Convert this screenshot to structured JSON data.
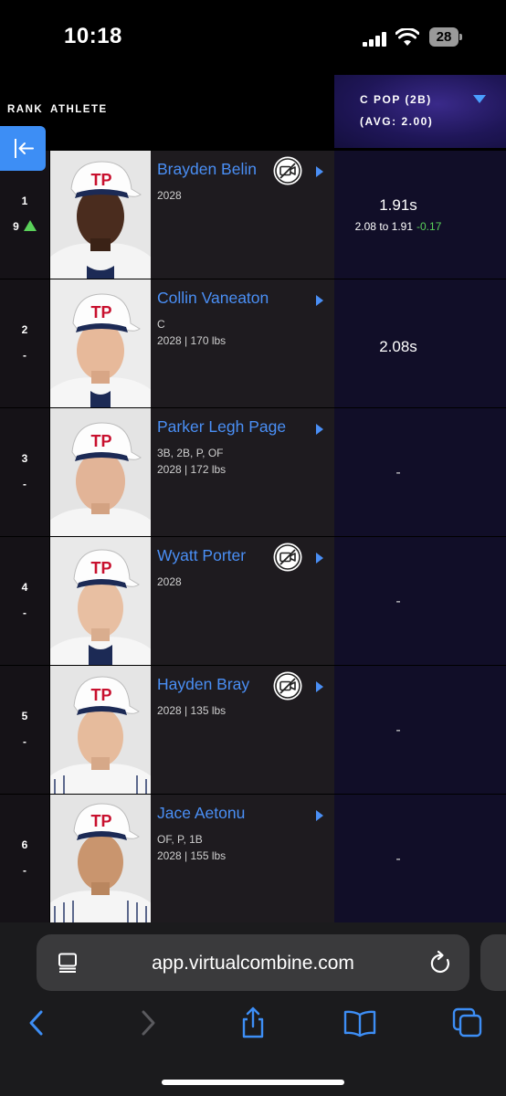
{
  "status": {
    "time": "10:18",
    "battery": "28"
  },
  "header": {
    "rank": "RANK",
    "athlete": "ATHLETE"
  },
  "metric": {
    "title": "C POP (2B)",
    "avg": "(AVG: 2.00)"
  },
  "icons": {
    "exit": "exit-icon",
    "no_video": "no-video-icon",
    "play": "play-arrow-icon",
    "sort": "chevron-down-icon"
  },
  "colors": {
    "accent": "#4a8ff5",
    "up": "#5ad15a",
    "metric_bg": "#110e28"
  },
  "rows": [
    {
      "rank": "1",
      "change": "9",
      "change_dir": "up",
      "name": "Brayden Belin",
      "positions": "",
      "details": "2028",
      "no_video": true,
      "metric": "1.91s",
      "range": "2.08 to 1.91",
      "delta": "-0.17"
    },
    {
      "rank": "2",
      "change": "-",
      "name": "Collin Vaneaton",
      "positions": "C",
      "details": "2028 | 170 lbs",
      "no_video": false,
      "metric": "2.08s"
    },
    {
      "rank": "3",
      "change": "-",
      "name": "Parker Legh Page",
      "positions": "3B, 2B, P, OF",
      "details": "2028 | 172 lbs",
      "no_video": false,
      "metric": "-"
    },
    {
      "rank": "4",
      "change": "-",
      "name": "Wyatt Porter",
      "positions": "",
      "details": "2028",
      "no_video": true,
      "metric": "-"
    },
    {
      "rank": "5",
      "change": "-",
      "name": "Hayden Bray",
      "positions": "",
      "details": "2028 | 135 lbs",
      "no_video": true,
      "metric": "-"
    },
    {
      "rank": "6",
      "change": "-",
      "name": "Jace Aetonu",
      "positions": "OF, P, 1B",
      "details": "2028 | 155 lbs",
      "no_video": false,
      "metric": "-"
    }
  ],
  "browser": {
    "url": "app.virtualcombine.com"
  }
}
